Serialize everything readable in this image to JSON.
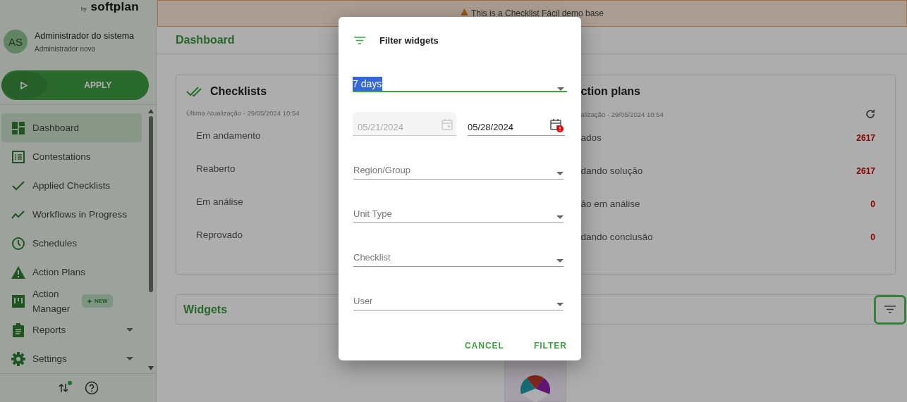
{
  "brand": {
    "by": "by",
    "name": "softplan"
  },
  "user": {
    "initials": "AS",
    "name": "Administrador do sistema",
    "role": "Administrador novo"
  },
  "apply_button": "APPLY",
  "nav": [
    {
      "label": "Dashboard",
      "selected": true,
      "has_submenu": false
    },
    {
      "label": "Contestations",
      "selected": false,
      "has_submenu": false
    },
    {
      "label": "Applied Checklists",
      "selected": false,
      "has_submenu": false
    },
    {
      "label": "Workflows in Progress",
      "selected": false,
      "has_submenu": false
    },
    {
      "label": "Schedules",
      "selected": false,
      "has_submenu": false
    },
    {
      "label": "Action Plans",
      "selected": false,
      "has_submenu": false
    },
    {
      "label": "Action Manager",
      "selected": false,
      "has_submenu": false,
      "badge": "NEW"
    },
    {
      "label": "Reports",
      "selected": false,
      "has_submenu": true
    },
    {
      "label": "Settings",
      "selected": false,
      "has_submenu": true
    }
  ],
  "banner": {
    "text": "This is a Checklist Fácil demo base"
  },
  "page_title": "Dashboard",
  "checklists_card": {
    "title": "Checklists",
    "updated": "Última Atualização - 29/05/2024 10:54",
    "rows": [
      "Em andamento",
      "Reaberto",
      "Em análise",
      "Reprovado"
    ]
  },
  "action_plans_card": {
    "title": "ction plans",
    "updated": "alização - 29/05/2024 10:54",
    "rows": [
      {
        "label": "ados",
        "value": "2617"
      },
      {
        "label": "dando solução",
        "value": "2617"
      },
      {
        "label": "ão em análise",
        "value": "0"
      },
      {
        "label": "dando conclusão",
        "value": "0"
      }
    ]
  },
  "widgets": {
    "title": "Widgets"
  },
  "dialog": {
    "title": "Filter widgets",
    "period": {
      "value": "7 days"
    },
    "start_date": {
      "value": "05/21/2024",
      "disabled": true
    },
    "end_date": {
      "value": "05/28/2024",
      "error": true
    },
    "selects": [
      {
        "placeholder": "Region/Group"
      },
      {
        "placeholder": "Unit Type"
      },
      {
        "placeholder": "Checklist"
      },
      {
        "placeholder": "User"
      }
    ],
    "buttons": [
      "CANCEL",
      "FILTER"
    ]
  }
}
